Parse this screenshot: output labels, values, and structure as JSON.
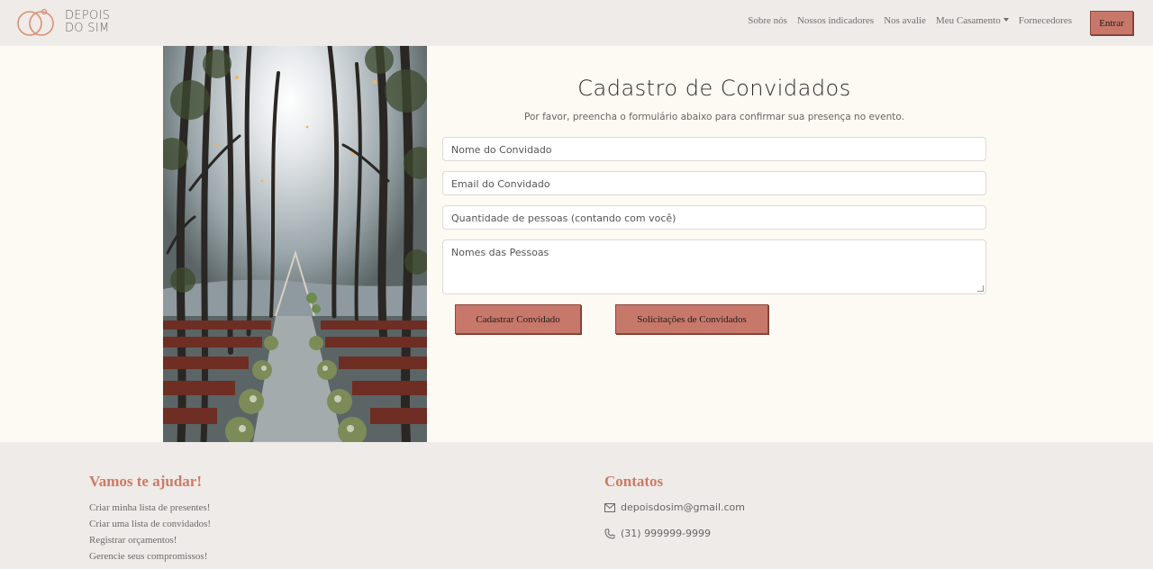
{
  "brand": {
    "line1": "DEPOIS",
    "line2": "DO SIM"
  },
  "nav": {
    "items": [
      "Sobre nós",
      "Nossos indicadores",
      "Nos avalie",
      "Meu Casamento",
      "Fornecedores"
    ],
    "login_label": "Entrar"
  },
  "form": {
    "title": "Cadastro de Convidados",
    "subtitle": "Por favor, preencha o formulário abaixo para confirmar sua presença no evento.",
    "name_placeholder": "Nome do Convidado",
    "email_placeholder": "Email do Convidado",
    "quantity_placeholder": "Quantidade de pessoas (contando com você)",
    "people_placeholder": "Nomes das Pessoas",
    "submit_label": "Cadastrar Convidado",
    "requests_label": "Solicitações de Convidados"
  },
  "footer": {
    "help_heading": "Vamos te ajudar!",
    "help_links": [
      "Criar minha lista de presentes!",
      "Criar uma lista de convidados!",
      "Registrar orçamentos!",
      "Gerencie seus compromissos!"
    ],
    "contacts_heading": "Contatos",
    "email": "depoisdosim@gmail.com",
    "phone": "(31) 999999-9999"
  },
  "colors": {
    "accent": "#c8786a",
    "heading": "#cc7a65",
    "nav_bg": "#efebe8",
    "page_bg": "#fdf9f3"
  },
  "icons": {
    "logo": "rings-logo",
    "dropdown": "caret-down-icon",
    "email": "envelope-icon",
    "phone": "phone-icon"
  }
}
